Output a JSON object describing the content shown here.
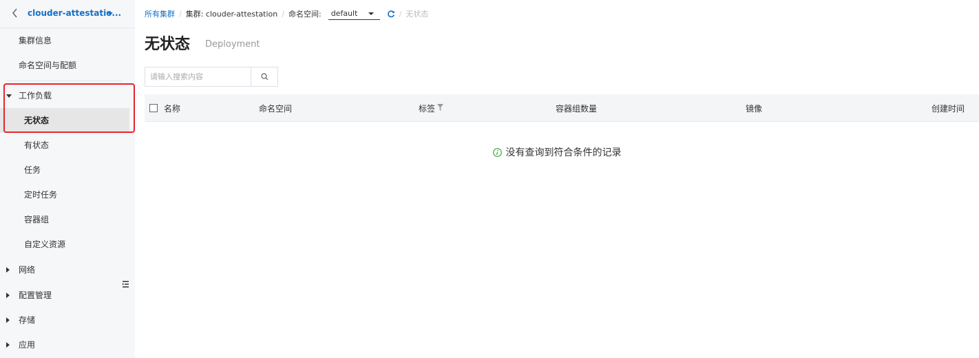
{
  "sidebar": {
    "cluster_name": "clouder-attestatio...",
    "items": {
      "cluster_info": "集群信息",
      "namespace_quota": "命名空间与配额",
      "workload": "工作负载",
      "stateless": "无状态",
      "stateful": "有状态",
      "job": "任务",
      "cronjob": "定时任务",
      "pod": "容器组",
      "custom_resource": "自定义资源",
      "network": "网络",
      "config": "配置管理",
      "storage": "存储",
      "app": "应用"
    }
  },
  "breadcrumb": {
    "all_clusters": "所有集群",
    "cluster": "集群: clouder-attestation",
    "namespace_label": "命名空间:",
    "namespace_value": "default",
    "current": "无状态"
  },
  "page": {
    "title": "无状态",
    "subtitle": "Deployment"
  },
  "search": {
    "placeholder": "请输入搜索内容"
  },
  "table": {
    "columns": {
      "name": "名称",
      "namespace": "命名空间",
      "labels": "标签",
      "pod_count": "容器组数量",
      "image": "镜像",
      "created": "创建时间"
    },
    "empty_text": "没有查询到符合条件的记录"
  },
  "colors": {
    "accent": "#1570c7",
    "highlight": "#e5242b",
    "success": "#3aa12f"
  }
}
